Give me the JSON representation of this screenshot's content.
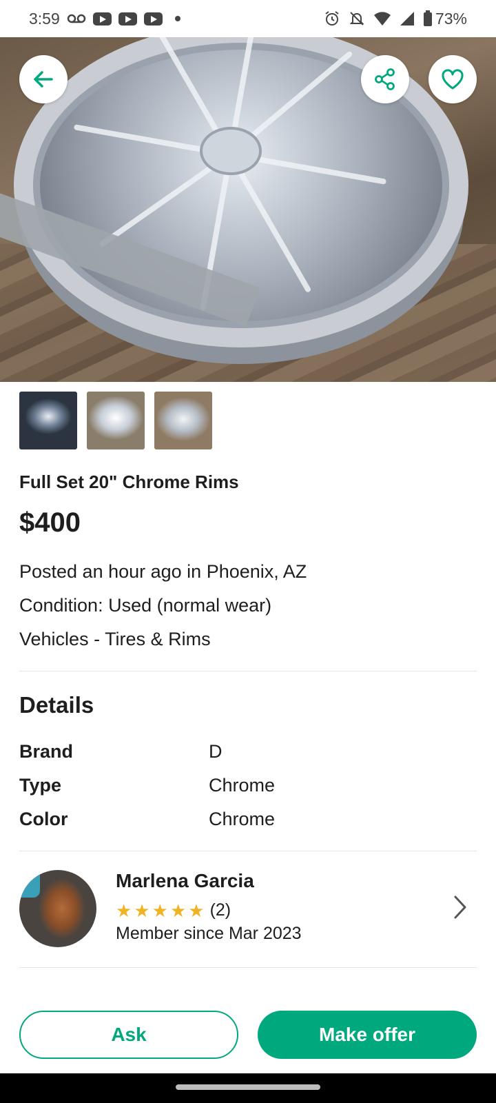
{
  "status_bar": {
    "time": "3:59",
    "battery": "73%",
    "icons_left": [
      "voicemail-icon",
      "youtube-icon",
      "youtube-icon",
      "youtube-icon",
      "dot-icon"
    ],
    "icons_right": [
      "alarm-icon",
      "bell-muted-icon",
      "wifi-icon",
      "signal-icon",
      "battery-icon"
    ]
  },
  "hero": {
    "buttons": {
      "back": "back-arrow-icon",
      "share": "share-icon",
      "favorite": "heart-icon"
    },
    "thumbnail_count": 3
  },
  "listing": {
    "title": "Full Set 20\" Chrome Rims",
    "price": "$400",
    "posted": "Posted an hour ago in Phoenix, AZ",
    "condition": "Condition: Used (normal wear)",
    "category": "Vehicles - Tires & Rims"
  },
  "details": {
    "heading": "Details",
    "rows": [
      {
        "key": "Brand",
        "value": "D"
      },
      {
        "key": "Type",
        "value": "Chrome"
      },
      {
        "key": "Color",
        "value": "Chrome"
      }
    ]
  },
  "seller": {
    "name": "Marlena Garcia",
    "rating": 5,
    "reviews": "(2)",
    "member_since": "Member since Mar 2023"
  },
  "actions": {
    "ask_label": "Ask",
    "offer_label": "Make offer"
  },
  "colors": {
    "accent": "#00a87e",
    "star": "#f0b323",
    "text": "#1e1e1e"
  }
}
